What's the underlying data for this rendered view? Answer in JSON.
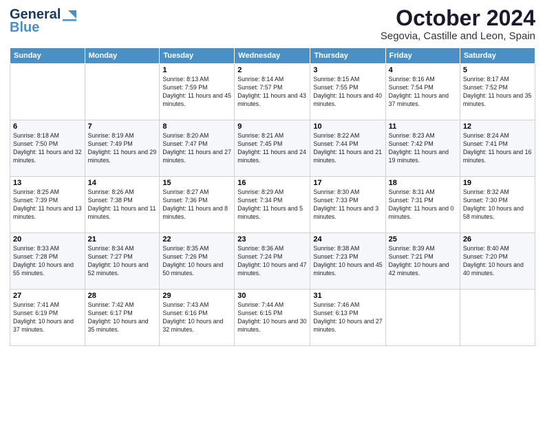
{
  "logo": {
    "line1": "General",
    "line2": "Blue"
  },
  "header": {
    "month": "October 2024",
    "location": "Segovia, Castille and Leon, Spain"
  },
  "weekdays": [
    "Sunday",
    "Monday",
    "Tuesday",
    "Wednesday",
    "Thursday",
    "Friday",
    "Saturday"
  ],
  "weeks": [
    [
      {
        "day": "",
        "info": ""
      },
      {
        "day": "",
        "info": ""
      },
      {
        "day": "1",
        "info": "Sunrise: 8:13 AM\nSunset: 7:59 PM\nDaylight: 11 hours and 45 minutes."
      },
      {
        "day": "2",
        "info": "Sunrise: 8:14 AM\nSunset: 7:57 PM\nDaylight: 11 hours and 43 minutes."
      },
      {
        "day": "3",
        "info": "Sunrise: 8:15 AM\nSunset: 7:55 PM\nDaylight: 11 hours and 40 minutes."
      },
      {
        "day": "4",
        "info": "Sunrise: 8:16 AM\nSunset: 7:54 PM\nDaylight: 11 hours and 37 minutes."
      },
      {
        "day": "5",
        "info": "Sunrise: 8:17 AM\nSunset: 7:52 PM\nDaylight: 11 hours and 35 minutes."
      }
    ],
    [
      {
        "day": "6",
        "info": "Sunrise: 8:18 AM\nSunset: 7:50 PM\nDaylight: 11 hours and 32 minutes."
      },
      {
        "day": "7",
        "info": "Sunrise: 8:19 AM\nSunset: 7:49 PM\nDaylight: 11 hours and 29 minutes."
      },
      {
        "day": "8",
        "info": "Sunrise: 8:20 AM\nSunset: 7:47 PM\nDaylight: 11 hours and 27 minutes."
      },
      {
        "day": "9",
        "info": "Sunrise: 8:21 AM\nSunset: 7:45 PM\nDaylight: 11 hours and 24 minutes."
      },
      {
        "day": "10",
        "info": "Sunrise: 8:22 AM\nSunset: 7:44 PM\nDaylight: 11 hours and 21 minutes."
      },
      {
        "day": "11",
        "info": "Sunrise: 8:23 AM\nSunset: 7:42 PM\nDaylight: 11 hours and 19 minutes."
      },
      {
        "day": "12",
        "info": "Sunrise: 8:24 AM\nSunset: 7:41 PM\nDaylight: 11 hours and 16 minutes."
      }
    ],
    [
      {
        "day": "13",
        "info": "Sunrise: 8:25 AM\nSunset: 7:39 PM\nDaylight: 11 hours and 13 minutes."
      },
      {
        "day": "14",
        "info": "Sunrise: 8:26 AM\nSunset: 7:38 PM\nDaylight: 11 hours and 11 minutes."
      },
      {
        "day": "15",
        "info": "Sunrise: 8:27 AM\nSunset: 7:36 PM\nDaylight: 11 hours and 8 minutes."
      },
      {
        "day": "16",
        "info": "Sunrise: 8:29 AM\nSunset: 7:34 PM\nDaylight: 11 hours and 5 minutes."
      },
      {
        "day": "17",
        "info": "Sunrise: 8:30 AM\nSunset: 7:33 PM\nDaylight: 11 hours and 3 minutes."
      },
      {
        "day": "18",
        "info": "Sunrise: 8:31 AM\nSunset: 7:31 PM\nDaylight: 11 hours and 0 minutes."
      },
      {
        "day": "19",
        "info": "Sunrise: 8:32 AM\nSunset: 7:30 PM\nDaylight: 10 hours and 58 minutes."
      }
    ],
    [
      {
        "day": "20",
        "info": "Sunrise: 8:33 AM\nSunset: 7:28 PM\nDaylight: 10 hours and 55 minutes."
      },
      {
        "day": "21",
        "info": "Sunrise: 8:34 AM\nSunset: 7:27 PM\nDaylight: 10 hours and 52 minutes."
      },
      {
        "day": "22",
        "info": "Sunrise: 8:35 AM\nSunset: 7:26 PM\nDaylight: 10 hours and 50 minutes."
      },
      {
        "day": "23",
        "info": "Sunrise: 8:36 AM\nSunset: 7:24 PM\nDaylight: 10 hours and 47 minutes."
      },
      {
        "day": "24",
        "info": "Sunrise: 8:38 AM\nSunset: 7:23 PM\nDaylight: 10 hours and 45 minutes."
      },
      {
        "day": "25",
        "info": "Sunrise: 8:39 AM\nSunset: 7:21 PM\nDaylight: 10 hours and 42 minutes."
      },
      {
        "day": "26",
        "info": "Sunrise: 8:40 AM\nSunset: 7:20 PM\nDaylight: 10 hours and 40 minutes."
      }
    ],
    [
      {
        "day": "27",
        "info": "Sunrise: 7:41 AM\nSunset: 6:19 PM\nDaylight: 10 hours and 37 minutes."
      },
      {
        "day": "28",
        "info": "Sunrise: 7:42 AM\nSunset: 6:17 PM\nDaylight: 10 hours and 35 minutes."
      },
      {
        "day": "29",
        "info": "Sunrise: 7:43 AM\nSunset: 6:16 PM\nDaylight: 10 hours and 32 minutes."
      },
      {
        "day": "30",
        "info": "Sunrise: 7:44 AM\nSunset: 6:15 PM\nDaylight: 10 hours and 30 minutes."
      },
      {
        "day": "31",
        "info": "Sunrise: 7:46 AM\nSunset: 6:13 PM\nDaylight: 10 hours and 27 minutes."
      },
      {
        "day": "",
        "info": ""
      },
      {
        "day": "",
        "info": ""
      }
    ]
  ]
}
